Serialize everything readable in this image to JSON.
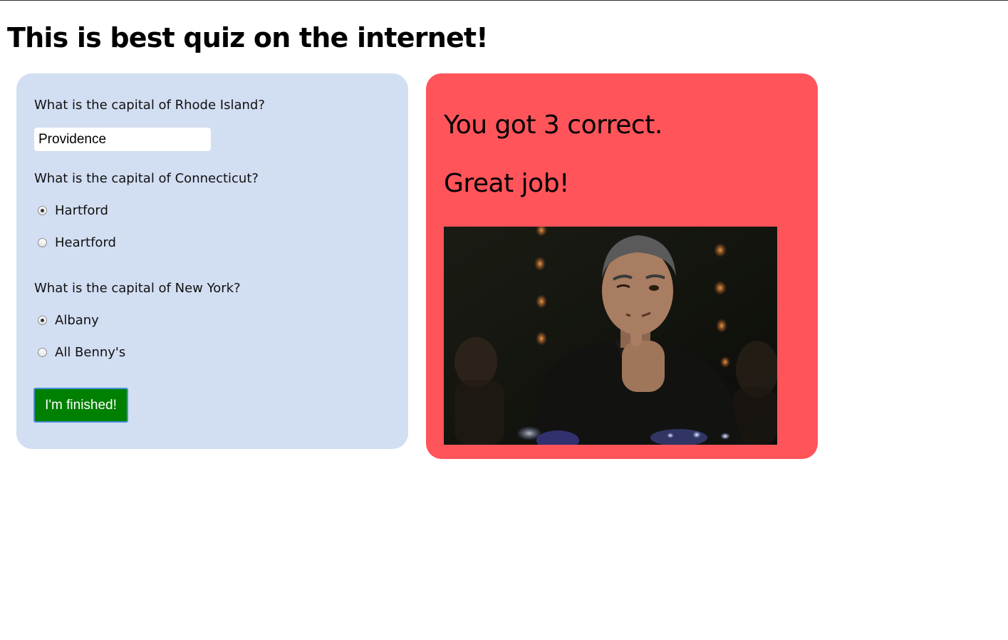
{
  "page": {
    "title": "This is best quiz on the internet!"
  },
  "quiz": {
    "questions": [
      {
        "text": "What is the capital of Rhode Island?",
        "type": "text",
        "value": "Providence"
      },
      {
        "text": "What is the capital of Connecticut?",
        "type": "radio",
        "options": [
          {
            "label": "Hartford",
            "checked": true
          },
          {
            "label": "Heartford",
            "checked": false
          }
        ]
      },
      {
        "text": "What is the capital of New York?",
        "type": "radio",
        "options": [
          {
            "label": "Albany",
            "checked": true
          },
          {
            "label": "All Benny's",
            "checked": false
          }
        ]
      }
    ],
    "submit_label": "I'm finished!"
  },
  "result": {
    "score_text": "You got 3 correct.",
    "message": "Great job!",
    "image_name": "man-winking-thumbs-up-gif"
  },
  "colors": {
    "quiz_panel_bg": "#d2def2",
    "result_panel_bg": "#ff545a",
    "button_bg": "#008000",
    "button_border": "#4a8fd8"
  }
}
